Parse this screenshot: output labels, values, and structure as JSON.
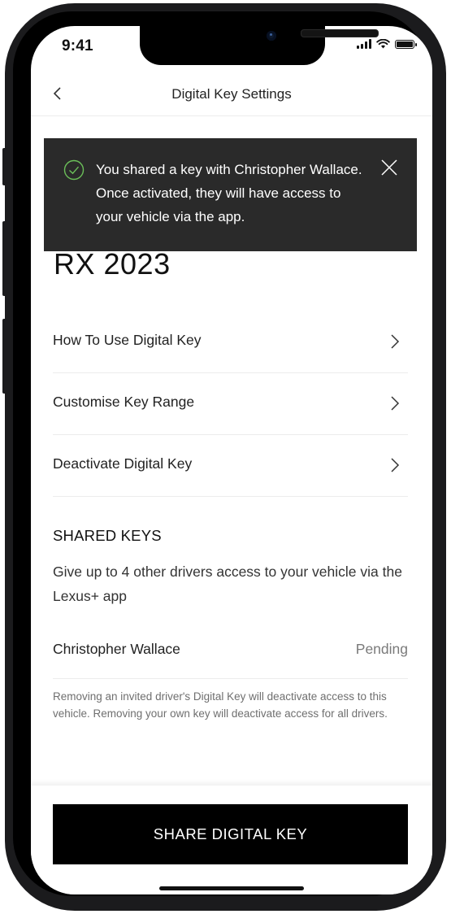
{
  "status_bar": {
    "time": "9:41"
  },
  "nav": {
    "title": "Digital Key Settings"
  },
  "toast": {
    "message": "You shared a key with Christopher Wallace. Once activated, they will have access to your vehicle via the app."
  },
  "vehicle": {
    "name": "RX 2023"
  },
  "menu": {
    "items": [
      {
        "label": "How To Use Digital Key"
      },
      {
        "label": "Customise Key Range"
      },
      {
        "label": "Deactivate Digital Key"
      }
    ]
  },
  "shared_keys": {
    "heading": "SHARED KEYS",
    "description": "Give up to 4 other drivers access to your vehicle via the Lexus+ app",
    "drivers": [
      {
        "name": "Christopher Wallace",
        "status": "Pending"
      }
    ],
    "disclaimer": "Removing an invited driver's Digital Key will deactivate access to this vehicle. Removing your own key will deactivate access for all drivers."
  },
  "footer": {
    "share_button_label": "SHARE DIGITAL KEY"
  },
  "colors": {
    "toast_bg": "#2a2a2a",
    "success_green": "#6bbf59",
    "button_bg": "#000000"
  }
}
